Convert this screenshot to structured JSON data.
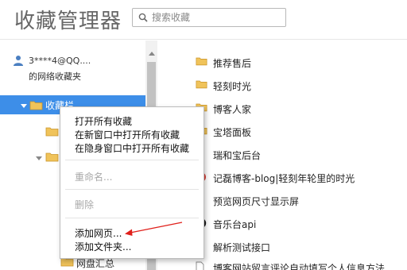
{
  "app": {
    "title": "收藏管理器"
  },
  "search": {
    "placeholder": "搜索收藏"
  },
  "sidebar": {
    "account_name": "3****4@QQ....",
    "account_sub": "的网络收藏夹",
    "selected_folder": "收藏栏",
    "partial_folder": "网盘汇总"
  },
  "context_menu": {
    "items": [
      {
        "label": "打开所有收藏",
        "enabled": true
      },
      {
        "label": "在新窗口中打开所有收藏",
        "enabled": true
      },
      {
        "label": "在隐身窗口中打开所有收藏",
        "enabled": true
      },
      {
        "label": "重命名...",
        "enabled": false
      },
      {
        "label": "删除",
        "enabled": false
      },
      {
        "label": "添加网页...",
        "enabled": true
      },
      {
        "label": "添加文件夹...",
        "enabled": true
      }
    ]
  },
  "main": {
    "items": [
      {
        "label": "推荐售后",
        "icon": "folder-icon"
      },
      {
        "label": "轻刻时光",
        "icon": "folder-icon"
      },
      {
        "label": "博客人家",
        "icon": "folder-icon"
      },
      {
        "label": "宝塔面板",
        "icon": "folder-icon"
      },
      {
        "label": "瑞和宝后台",
        "icon": "page-icon"
      },
      {
        "label": "记磊博客-blog|轻刻年轮里的时光",
        "icon": "site-icon"
      },
      {
        "label": "预览网页尺寸显示屏",
        "icon": "page-icon"
      },
      {
        "label": "音乐台api",
        "icon": "music-site-icon"
      },
      {
        "label": "解析测试接口",
        "icon": "page-icon"
      },
      {
        "label": "博客网站留言评论自动填写个人信息方法",
        "icon": "page-icon"
      }
    ]
  },
  "colors": {
    "selection": "#3d8ee8",
    "folder": "#f0c35a",
    "annotation_arrow": "#e0201b"
  }
}
